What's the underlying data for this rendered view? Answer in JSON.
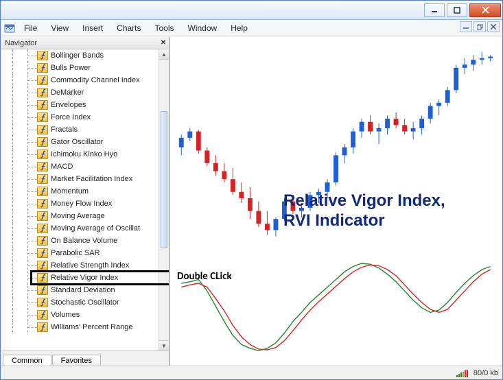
{
  "menu": {
    "file": "File",
    "view": "View",
    "insert": "Insert",
    "charts": "Charts",
    "tools": "Tools",
    "window": "Window",
    "help": "Help"
  },
  "navigator": {
    "title": "Navigator",
    "tabs": {
      "common": "Common",
      "favorites": "Favorites"
    },
    "items": [
      "Bollinger Bands",
      "Bulls Power",
      "Commodity Channel Index",
      "DeMarker",
      "Envelopes",
      "Force Index",
      "Fractals",
      "Gator Oscillator",
      "Ichimoku Kinko Hyo",
      "MACD",
      "Market Facilitation Index",
      "Momentum",
      "Money Flow Index",
      "Moving Average",
      "Moving Average of Oscillat",
      "On Balance Volume",
      "Parabolic SAR",
      "Relative Strength Index",
      "Relative Vigor Index",
      "Standard Deviation",
      "Stochastic Oscillator",
      "Volumes",
      "Williams' Percent Range"
    ]
  },
  "annotations": {
    "double_click": "Double CLick",
    "rvi_line1": "Relative Vigor Index,",
    "rvi_line2": "RVI Indicator"
  },
  "chart_data": {
    "type": "candlestick+line",
    "candles": [
      {
        "o": 100,
        "h": 108,
        "l": 95,
        "c": 106
      },
      {
        "o": 106,
        "h": 112,
        "l": 104,
        "c": 110
      },
      {
        "o": 110,
        "h": 111,
        "l": 96,
        "c": 98
      },
      {
        "o": 98,
        "h": 100,
        "l": 88,
        "c": 90
      },
      {
        "o": 90,
        "h": 95,
        "l": 82,
        "c": 85
      },
      {
        "o": 85,
        "h": 90,
        "l": 78,
        "c": 80
      },
      {
        "o": 80,
        "h": 87,
        "l": 70,
        "c": 72
      },
      {
        "o": 72,
        "h": 78,
        "l": 65,
        "c": 68
      },
      {
        "o": 68,
        "h": 75,
        "l": 55,
        "c": 60
      },
      {
        "o": 60,
        "h": 66,
        "l": 50,
        "c": 52
      },
      {
        "o": 52,
        "h": 60,
        "l": 45,
        "c": 48
      },
      {
        "o": 48,
        "h": 56,
        "l": 44,
        "c": 55
      },
      {
        "o": 55,
        "h": 68,
        "l": 54,
        "c": 66
      },
      {
        "o": 66,
        "h": 70,
        "l": 58,
        "c": 60
      },
      {
        "o": 60,
        "h": 65,
        "l": 56,
        "c": 62
      },
      {
        "o": 62,
        "h": 72,
        "l": 60,
        "c": 70
      },
      {
        "o": 70,
        "h": 74,
        "l": 65,
        "c": 72
      },
      {
        "o": 72,
        "h": 80,
        "l": 68,
        "c": 78
      },
      {
        "o": 78,
        "h": 97,
        "l": 76,
        "c": 95
      },
      {
        "o": 95,
        "h": 102,
        "l": 90,
        "c": 100
      },
      {
        "o": 100,
        "h": 112,
        "l": 96,
        "c": 110
      },
      {
        "o": 110,
        "h": 118,
        "l": 106,
        "c": 116
      },
      {
        "o": 116,
        "h": 120,
        "l": 108,
        "c": 110
      },
      {
        "o": 110,
        "h": 115,
        "l": 102,
        "c": 112
      },
      {
        "o": 112,
        "h": 120,
        "l": 108,
        "c": 118
      },
      {
        "o": 118,
        "h": 122,
        "l": 112,
        "c": 114
      },
      {
        "o": 114,
        "h": 118,
        "l": 108,
        "c": 110
      },
      {
        "o": 110,
        "h": 116,
        "l": 105,
        "c": 112
      },
      {
        "o": 112,
        "h": 120,
        "l": 108,
        "c": 118
      },
      {
        "o": 118,
        "h": 128,
        "l": 115,
        "c": 126
      },
      {
        "o": 126,
        "h": 130,
        "l": 120,
        "c": 128
      },
      {
        "o": 128,
        "h": 138,
        "l": 126,
        "c": 136
      },
      {
        "o": 136,
        "h": 152,
        "l": 134,
        "c": 150
      },
      {
        "o": 150,
        "h": 156,
        "l": 146,
        "c": 152
      },
      {
        "o": 152,
        "h": 158,
        "l": 148,
        "c": 155
      },
      {
        "o": 155,
        "h": 160,
        "l": 152,
        "c": 156
      },
      {
        "o": 156,
        "h": 158,
        "l": 154,
        "c": 157
      }
    ],
    "rvi_main": [
      30,
      32,
      35,
      20,
      0,
      -20,
      -38,
      -50,
      -55,
      -58,
      -55,
      -48,
      -35,
      -20,
      -8,
      5,
      15,
      25,
      35,
      45,
      52,
      56,
      55,
      50,
      42,
      32,
      20,
      8,
      -2,
      -8,
      -5,
      5,
      18,
      30,
      40,
      48,
      52
    ],
    "rvi_signal": [
      25,
      28,
      30,
      25,
      10,
      -6,
      -25,
      -40,
      -50,
      -56,
      -57,
      -54,
      -45,
      -32,
      -18,
      -5,
      6,
      16,
      26,
      36,
      45,
      51,
      54,
      53,
      48,
      40,
      28,
      16,
      5,
      -4,
      -8,
      -4,
      8,
      20,
      32,
      42,
      48
    ],
    "ylim_candles": [
      40,
      165
    ],
    "ylim_rvi": [
      -65,
      65
    ]
  },
  "status": {
    "kb": "80/0 kb"
  },
  "colors": {
    "bull": "#1f5fd6",
    "bear": "#d62222",
    "rvi_main": "#1b8a2b",
    "rvi_signal": "#d62222"
  }
}
